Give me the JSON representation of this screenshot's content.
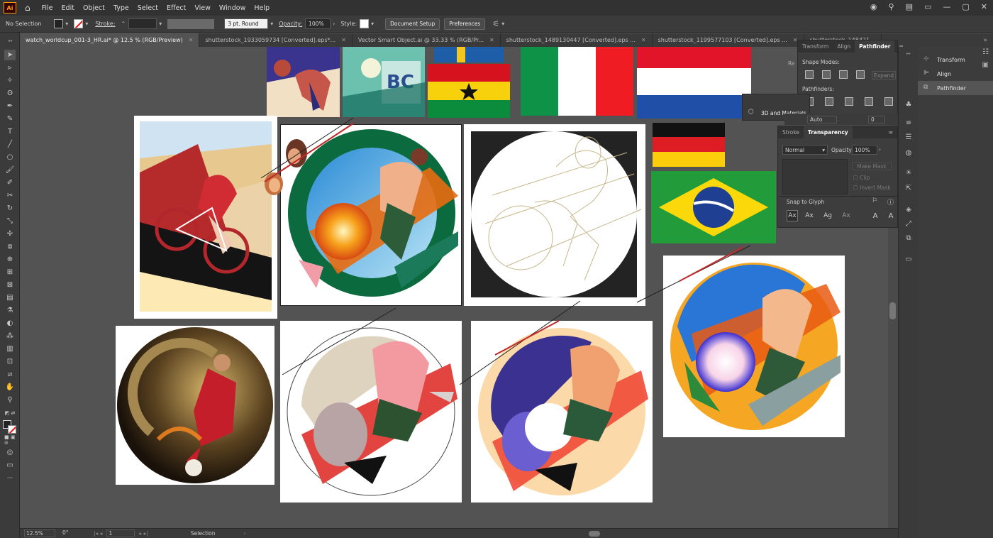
{
  "app": {
    "logo": "Ai"
  },
  "menu": {
    "items": [
      "File",
      "Edit",
      "Object",
      "Type",
      "Select",
      "Effect",
      "View",
      "Window",
      "Help"
    ]
  },
  "control": {
    "selection_state": "No Selection",
    "stroke_label": "Stroke:",
    "brush_value": "3 pt. Round",
    "opacity_label": "Opacity:",
    "opacity_value": "100%",
    "style_label": "Style:",
    "document_setup": "Document Setup",
    "preferences": "Preferences"
  },
  "tabs": [
    {
      "label": "watch_worldcup_001-3_HR.ai* @ 12.5 % (RGB/Preview)",
      "active": true
    },
    {
      "label": "shutterstock_1933059734 [Converted].eps*..."
    },
    {
      "label": "Vector Smart Object.ai @ 33.33 % (RGB/Pr..."
    },
    {
      "label": "shutterstock_1489130447 [Converted].eps ..."
    },
    {
      "label": "shutterstock_1199577103 [Converted].eps ..."
    },
    {
      "label": "shutterstock_148421..."
    }
  ],
  "pathfinder_panel": {
    "tabs": [
      "Transform",
      "Align",
      "Pathfinder"
    ],
    "shape_modes": "Shape Modes:",
    "expand": "Expand",
    "pathfinders": "Pathfinders:"
  },
  "materials_panel": {
    "label": "3D and Materials"
  },
  "transparency_panel": {
    "tabs": [
      "Stroke",
      "Transparency"
    ],
    "blend_mode": "Normal",
    "opacity_label": "Opacity:",
    "opacity_value": "100%",
    "make_mask": "Make Mask",
    "clip": "Clip",
    "invert_mask": "Invert Mask",
    "snap_to_glyph": "Snap to Glyph",
    "partial_label": "Re",
    "auto_value": "Auto",
    "zero_value": "0"
  },
  "dock": {
    "items": [
      "Transform",
      "Align",
      "Pathfinder"
    ],
    "selected": "Pathfinder"
  },
  "status": {
    "zoom": "12.5%",
    "rotation": "0°",
    "artboard": "1",
    "tool": "Selection"
  },
  "colors": {
    "accent": "#ff9a00",
    "ui_dark": "#323232",
    "canvas": "#535353"
  }
}
